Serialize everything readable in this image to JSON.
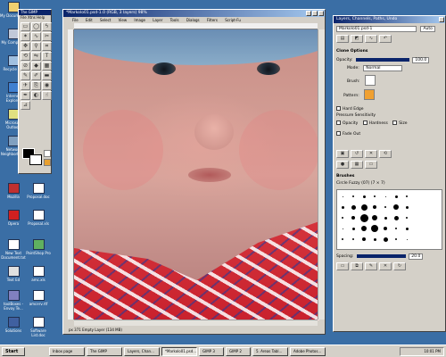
{
  "desktop": {
    "icons": [
      {
        "label": "My Documents"
      },
      {
        "label": "My Computer"
      },
      {
        "label": "Recycle Bin"
      },
      {
        "label": "Internet Explorer"
      },
      {
        "label": "Microsoft Outlook"
      },
      {
        "label": "Network Neighborhood"
      },
      {
        "label": "Mozilla"
      },
      {
        "label": "Proposal.doc"
      },
      {
        "label": "Opera"
      },
      {
        "label": "Proposal.xls"
      },
      {
        "label": "New Text Document.txt"
      },
      {
        "label": "PaintShop Pro"
      },
      {
        "label": "Text Ed"
      },
      {
        "label": "amc.xls"
      },
      {
        "label": "toolBoxes - Envoy Te..."
      },
      {
        "label": "amcerv.rtf"
      },
      {
        "label": "Solutions"
      },
      {
        "label": "Software List.doc"
      }
    ]
  },
  "toolbox": {
    "title": "The GIMP",
    "menu": "File Xtns Help",
    "tools": [
      "rect-select",
      "ellipse-select",
      "free-select",
      "fuzzy-select",
      "bezier-select",
      "scissors",
      "move",
      "magnify",
      "crop",
      "transform",
      "flip",
      "text",
      "color-picker",
      "bucket-fill",
      "blend",
      "pencil",
      "paintbrush",
      "eraser",
      "airbrush",
      "clone",
      "convolve",
      "ink",
      "dodge-burn",
      "smudge",
      "measure"
    ]
  },
  "image_window": {
    "title": "*Markolo01.psd-1.0 (RGB, 3 layers) 98%",
    "menu": [
      "File",
      "Edit",
      "Select",
      "View",
      "Image",
      "Layer",
      "Tools",
      "Dialogs",
      "Filters",
      "Script-Fu"
    ],
    "status": "px 371 Empty Layer (134 MB)"
  },
  "dock": {
    "title": "Layers, Channels, Paths, Undo",
    "image_select": "Markolo01.psd-1",
    "auto_label": "Auto",
    "tool_options_title": "Clone Options",
    "opacity_label": "Opacity:",
    "opacity_value": "100.0",
    "mode_label": "Mode:",
    "mode_value": "Normal",
    "brush_label": "Brush:",
    "pattern_label": "Pattern:",
    "hard_edge_label": "Hard Edge",
    "pressure_label": "Pressure Sensitivity",
    "opacity_cb": "Opacity",
    "hardness_cb": "Hardness",
    "size_cb": "Size",
    "fade_label": "Fade Out",
    "brushes_title": "Brushes",
    "brush_name": "Circle Fuzzy (07) (7 × 7)",
    "spacing_label": "Spacing:",
    "spacing_value": "20.0"
  },
  "taskbar": {
    "start": "Start",
    "tasks": [
      "Inbox page",
      "The GIMP",
      "Layers, Chan...",
      "*Markolo01.psd...",
      "GIMP 3",
      "GIMP 2",
      "5. Areas Tabl...",
      "Adobe Photos..."
    ],
    "clock": "10:01 PM"
  },
  "colors": {
    "desktop": "#3a6ea5",
    "titlebar": "#0a246a",
    "window": "#d4d0c8"
  }
}
